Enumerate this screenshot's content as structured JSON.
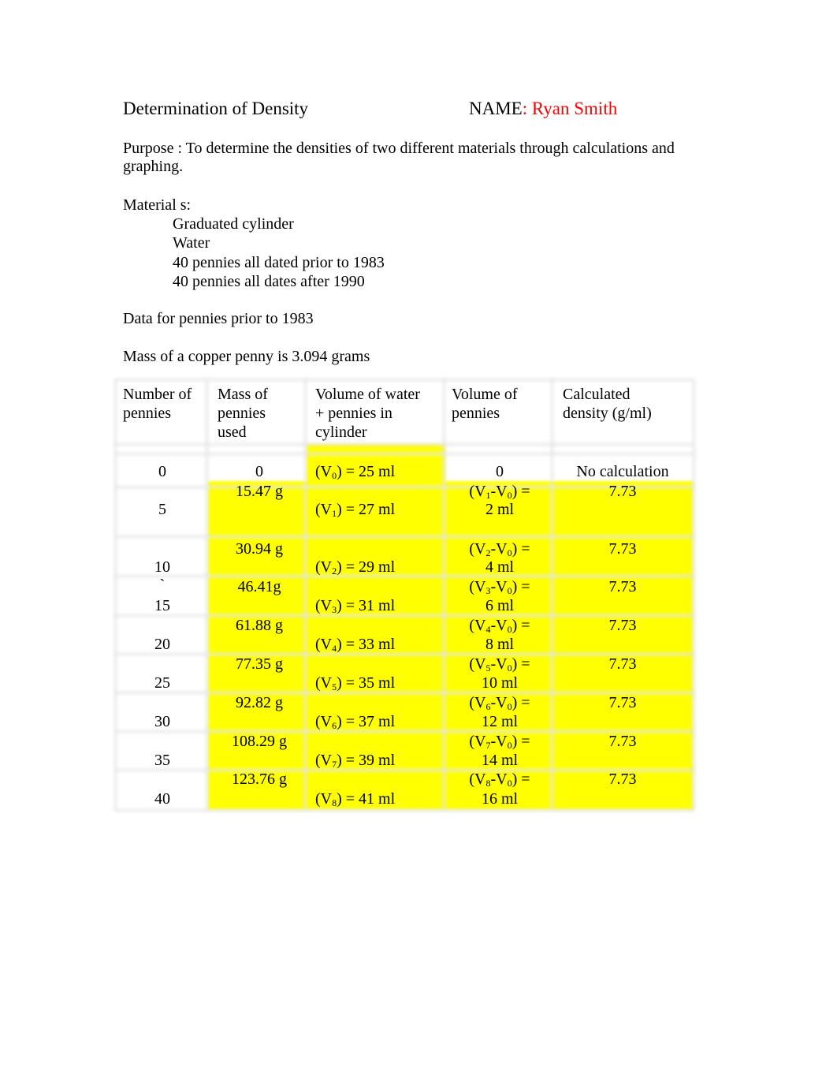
{
  "header": {
    "title": "Determination of Density",
    "name_label": "NAME",
    "name_value": ": Ryan Smith"
  },
  "purpose": "Purpose :  To determine the densities of two different materials through calculations and graphing.",
  "materials": {
    "heading": "Material  s:",
    "items": [
      "Graduated cylinder",
      "Water",
      "40 pennies all dated prior to 1983",
      "40 pennies all dates after 1990"
    ]
  },
  "data_heading": "Data for pennies prior to 1983",
  "mass_note": "Mass of a copper penny is 3.094 grams",
  "highlight_color": "#ffff00",
  "name_color": "#ff0000",
  "table": {
    "headers": [
      [
        "Number of",
        "pennies"
      ],
      [
        "Mass of",
        "pennies",
        "used"
      ],
      [
        "Volume of water",
        "+ pennies in",
        "cylinder"
      ],
      [
        "Volume of",
        "pennies"
      ],
      [
        "Calculated",
        "density  (g/ml)"
      ]
    ],
    "first_row": {
      "number": "0",
      "mass": "0",
      "v_label": "V",
      "v_sub": "0",
      "v_value": " =  25 ml",
      "volume": "0",
      "density": "No calculation"
    },
    "rows": [
      {
        "number": "5",
        "mass": "15.47 g",
        "v_sub": "1",
        "v_value": "27 ml",
        "diff_sub": "1",
        "diff_value": "2 ml",
        "density": "7.73"
      },
      {
        "number": "10",
        "mass": "30.94 g",
        "v_sub": "2",
        "v_value": "29 ml",
        "diff_sub": "2",
        "diff_value": "4 ml",
        "density": "7.73"
      },
      {
        "number": "15",
        "mass": "46.41g",
        "v_sub": "3",
        "v_value": "31 ml",
        "diff_sub": "3",
        "diff_value": "6 ml",
        "density": "7.73",
        "stray": "`"
      },
      {
        "number": "20",
        "mass": "61.88 g",
        "v_sub": "4",
        "v_value": "33 ml",
        "diff_sub": "4",
        "diff_value": "8 ml",
        "density": "7.73"
      },
      {
        "number": "25",
        "mass": "77.35 g",
        "v_sub": "5",
        "v_value": "35 ml",
        "diff_sub": "5",
        "diff_value": "10 ml",
        "density": "7.73"
      },
      {
        "number": "30",
        "mass": "92.82 g",
        "v_sub": "6",
        "v_value": "37 ml",
        "diff_sub": "6",
        "diff_value": "12 ml",
        "density": "7.73"
      },
      {
        "number": "35",
        "mass": "108.29 g",
        "v_sub": "7",
        "v_value": "39 ml",
        "diff_sub": "7",
        "diff_value": "14 ml",
        "density": "7.73"
      },
      {
        "number": "40",
        "mass": "123.76 g",
        "v_sub": "8",
        "v_value": "41 ml",
        "diff_sub": "8",
        "diff_value": "16 ml",
        "density": "7.73"
      }
    ]
  }
}
